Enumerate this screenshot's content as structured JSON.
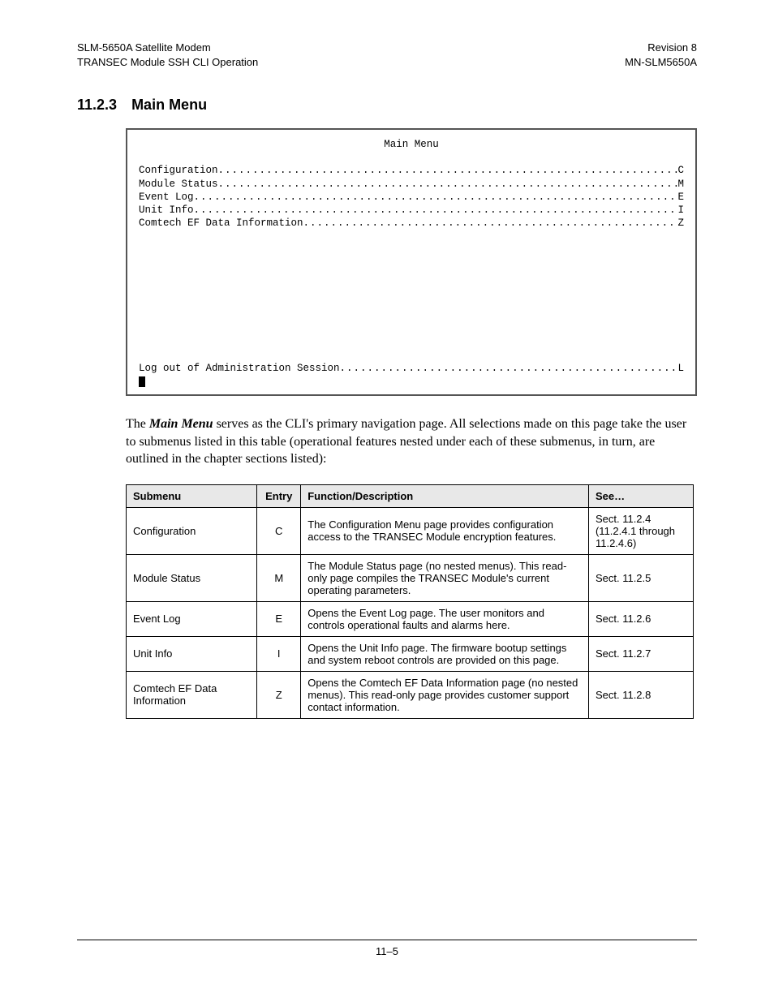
{
  "header": {
    "left1": "SLM-5650A Satellite Modem",
    "left2": "TRANSEC Module SSH CLI Operation",
    "right1": "Revision 8",
    "right2": "MN-SLM5650A"
  },
  "section": {
    "number": "11.2.3",
    "title": "Main Menu"
  },
  "terminal": {
    "title": "Main Menu",
    "items": [
      {
        "label": "Configuration",
        "key": "C"
      },
      {
        "label": "Module Status",
        "key": "M"
      },
      {
        "label": "Event Log",
        "key": "E"
      },
      {
        "label": "Unit Info",
        "key": "I"
      },
      {
        "label": "Comtech EF Data Information",
        "key": "Z"
      }
    ],
    "logout": {
      "label": "Log out of Administration Session",
      "key": "L"
    }
  },
  "paragraph": {
    "prefix": "The ",
    "mm": "Main Menu",
    "rest": " serves as the CLI's primary navigation page. All selections made on this page take the user to submenus listed in this table (operational features nested under each of these submenus, in turn, are outlined in the chapter sections listed):"
  },
  "table": {
    "headers": {
      "submenu": "Submenu",
      "entry": "Entry",
      "desc": "Function/Description",
      "see": "See…"
    },
    "rows": [
      {
        "submenu": "Configuration",
        "entry": "C",
        "desc": "The Configuration Menu page provides configuration access to the TRANSEC Module encryption features.",
        "see": "Sect. 11.2.4 (11.2.4.1 through 11.2.4.6)"
      },
      {
        "submenu": "Module Status",
        "entry": "M",
        "desc": "The Module Status page (no nested menus). This read-only page compiles the TRANSEC Module's current operating parameters.",
        "see": "Sect. 11.2.5"
      },
      {
        "submenu": "Event Log",
        "entry": "E",
        "desc": "Opens the Event Log page. The user monitors and controls operational faults and alarms here.",
        "see": "Sect. 11.2.6"
      },
      {
        "submenu": "Unit Info",
        "entry": "I",
        "desc": "Opens the Unit Info page. The firmware bootup settings and system reboot controls are provided on this page.",
        "see": "Sect. 11.2.7"
      },
      {
        "submenu": "Comtech EF Data Information",
        "entry": "Z",
        "desc": "Opens the Comtech EF Data Information page (no nested menus). This read-only page provides customer support contact information.",
        "see": "Sect. 11.2.8"
      }
    ]
  },
  "footer": {
    "page": "11–5"
  }
}
